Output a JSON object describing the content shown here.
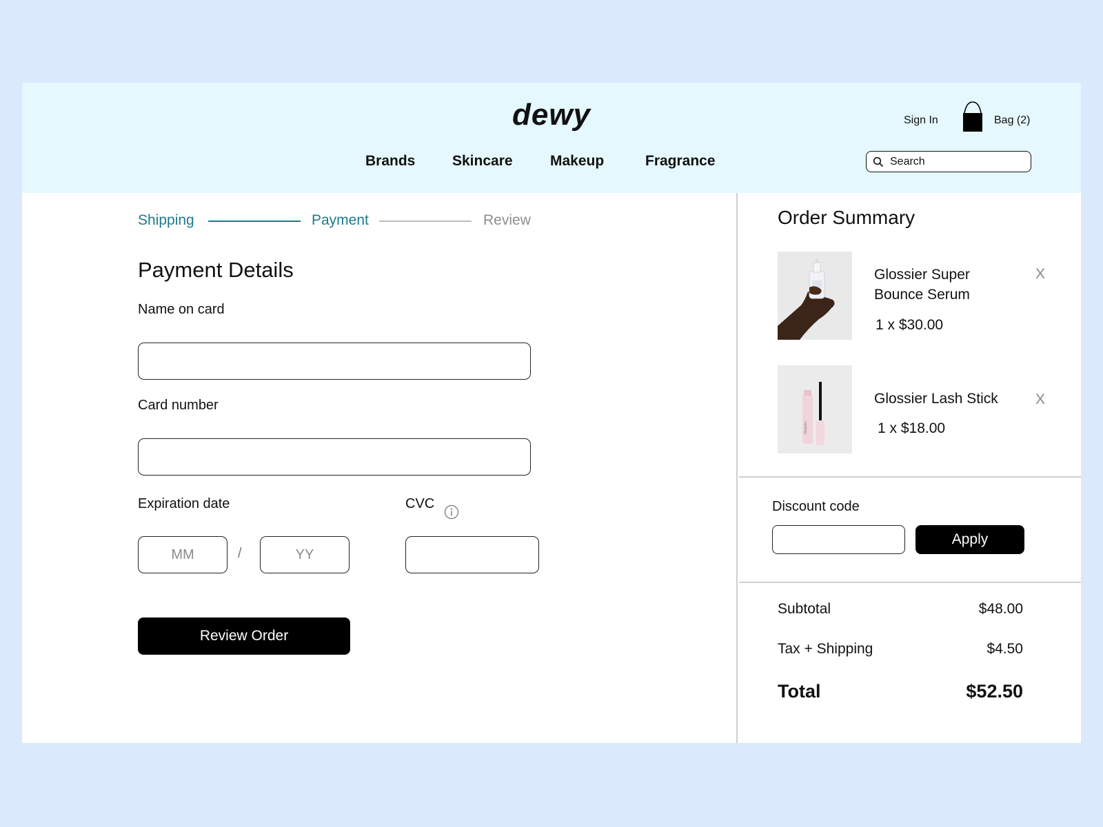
{
  "header": {
    "logo": "dewy",
    "nav": [
      "Brands",
      "Skincare",
      "Makeup",
      "Fragrance"
    ],
    "sign_in": "Sign In",
    "bag": "Bag (2)",
    "search_placeholder": "Search"
  },
  "checkout": {
    "steps": [
      {
        "label": "Shipping",
        "state": "done"
      },
      {
        "label": "Payment",
        "state": "current"
      },
      {
        "label": "Review",
        "state": "upcoming"
      }
    ],
    "title": "Payment Details",
    "name_label": "Name on card",
    "name_value": "",
    "card_label": "Card number",
    "card_value": "",
    "exp_label": "Expiration date",
    "mm_placeholder": "MM",
    "yy_placeholder": "YY",
    "slash": "/",
    "cvc_label": "CVC",
    "cvc_value": "",
    "review_button": "Review Order"
  },
  "summary": {
    "title": "Order Summary",
    "items": [
      {
        "name": "Glossier Super Bounce Serum",
        "qty_price": "1 x $30.00",
        "remove": "X",
        "thumb": "serum-product-image"
      },
      {
        "name": "Glossier Lash Stick",
        "qty_price": "1 x $18.00",
        "remove": "X",
        "thumb": "mascara-product-image"
      }
    ],
    "discount_label": "Discount code",
    "discount_value": "",
    "apply_button": "Apply",
    "subtotal_label": "Subtotal",
    "subtotal_value": "$48.00",
    "tax_label": "Tax + Shipping",
    "tax_value": "$4.50",
    "total_label": "Total",
    "total_value": "$52.50"
  },
  "colors": {
    "page_bg": "#dbe9fd",
    "header_bg": "#e5f8fe",
    "accent": "#1b7b8a",
    "inactive": "#8d8d8d",
    "button": "#000000"
  }
}
